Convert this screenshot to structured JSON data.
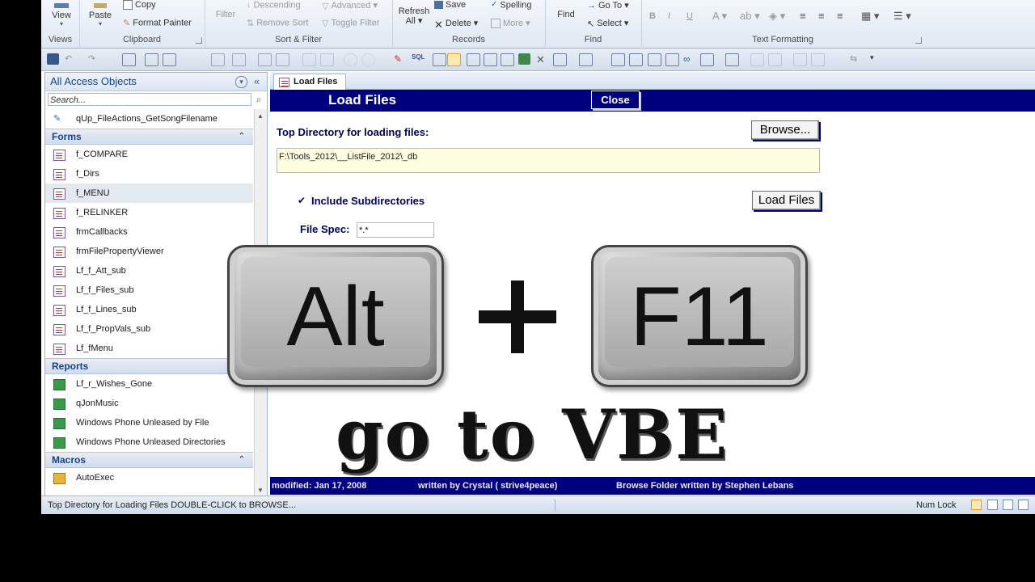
{
  "ribbon": {
    "groups": {
      "views": "Views",
      "clipboard": "Clipboard",
      "sort_filter": "Sort & Filter",
      "records": "Records",
      "find": "Find",
      "text_formatting": "Text Formatting"
    },
    "view": "View",
    "paste": "Paste",
    "copy": "Copy",
    "format_painter": "Format Painter",
    "filter": "Filter",
    "descending": "Descending",
    "remove_sort": "Remove Sort",
    "advanced": "Advanced",
    "toggle_filter": "Toggle Filter",
    "refresh_all": "Refresh\nAll",
    "save": "Save",
    "delete": "Delete",
    "spelling": "Spelling",
    "more": "More",
    "find": "Find",
    "goto": "Go To",
    "select": "Select"
  },
  "nav": {
    "title": "All Access Objects",
    "search_placeholder": "Search...",
    "query_item": "qUp_FileActions_GetSongFilename",
    "forms_header": "Forms",
    "forms": [
      "f_COMPARE",
      "f_Dirs",
      "f_MENU",
      "f_RELINKER",
      "frmCallbacks",
      "frmFilePropertyViewer",
      "Lf_f_Att_sub",
      "Lf_f_Files_sub",
      "Lf_f_Lines_sub",
      "Lf_f_PropVals_sub",
      "Lf_fMenu"
    ],
    "reports_header": "Reports",
    "reports": [
      "Lf_r_Wishes_Gone",
      "qJonMusic",
      "Windows Phone Unleased by File",
      "Windows Phone Unleased Directories"
    ],
    "macros_header": "Macros",
    "macros": [
      "AutoExec"
    ]
  },
  "doc": {
    "tab_label": "Load Files",
    "header_title": "Load Files",
    "close_label": "Close",
    "top_dir_label": "Top Directory for loading files:",
    "browse_label": "Browse...",
    "dir_value": "F:\\Tools_2012\\__ListFile_2012\\_db",
    "include_subdirs_label": "Include Subdirectories",
    "load_files_label": "Load Files",
    "file_spec_label": "File Spec:",
    "file_spec_value": "*.*",
    "footer_modified": "modified:  Jan 17, 2008",
    "footer_written": "written by Crystal ( strive4peace)",
    "footer_browse": "Browse Folder written by Stephen Lebans"
  },
  "status": {
    "text": "Top Directory for Loading Files  DOUBLE-CLICK to BROWSE...",
    "num_lock": "Num Lock"
  },
  "overlay": {
    "key1": "Alt",
    "key2": "F11",
    "caption": "go to VBE"
  }
}
